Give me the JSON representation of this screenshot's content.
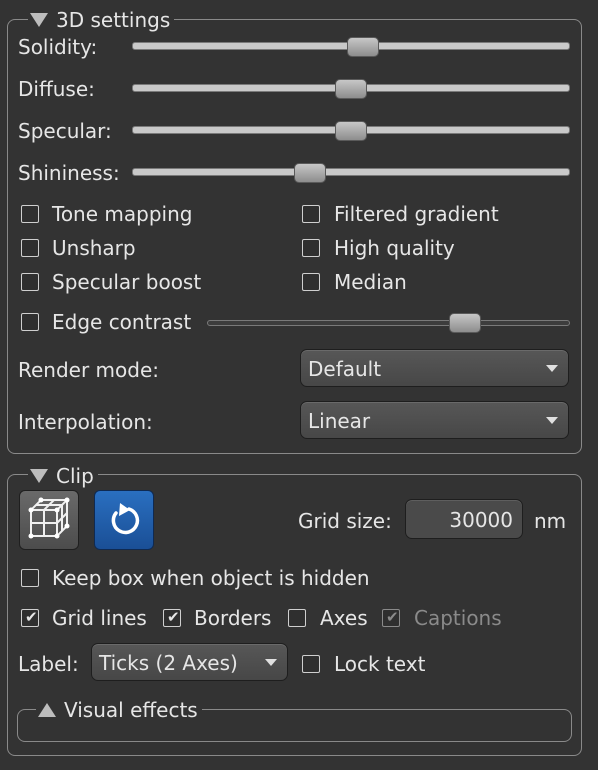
{
  "settings3d": {
    "title": "3D settings",
    "sliders": [
      {
        "label": "Solidity:",
        "value": 0.53
      },
      {
        "label": "Diffuse:",
        "value": 0.5
      },
      {
        "label": "Specular:",
        "value": 0.5
      },
      {
        "label": "Shininess:",
        "value": 0.4
      }
    ],
    "checkboxes": [
      {
        "label": "Tone mapping",
        "checked": false
      },
      {
        "label": "Filtered gradient",
        "checked": false
      },
      {
        "label": "Unsharp",
        "checked": false
      },
      {
        "label": "High quality",
        "checked": false
      },
      {
        "label": "Specular boost",
        "checked": false
      },
      {
        "label": "Median",
        "checked": false
      }
    ],
    "edge_contrast": {
      "label": "Edge contrast",
      "checked": false,
      "value": 0.73
    },
    "render_mode": {
      "label": "Render mode:",
      "value": "Default"
    },
    "interpolation": {
      "label": "Interpolation:",
      "value": "Linear"
    }
  },
  "clip": {
    "title": "Clip",
    "buttons": [
      {
        "icon": "cube-grid-icon"
      },
      {
        "icon": "reset-icon",
        "accent": "#1e5fae"
      }
    ],
    "grid_size": {
      "label": "Grid size:",
      "value": "30000",
      "unit": "nm"
    },
    "keep_box": {
      "label": "Keep box when object is hidden",
      "checked": false
    },
    "grid_lines": {
      "label": "Grid lines",
      "checked": true
    },
    "borders": {
      "label": "Borders",
      "checked": true
    },
    "axes": {
      "label": "Axes",
      "checked": false
    },
    "captions": {
      "label": "Captions",
      "checked": true,
      "disabled": true
    },
    "label": {
      "label": "Label:",
      "value": "Ticks (2 Axes)"
    },
    "lock_text": {
      "label": "Lock text",
      "checked": false
    }
  },
  "visual_effects": {
    "title": "Visual effects"
  }
}
